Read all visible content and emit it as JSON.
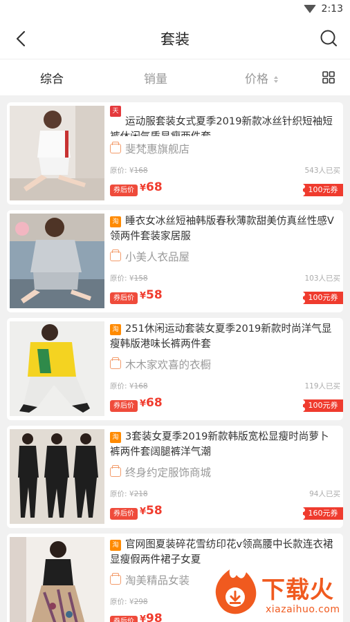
{
  "status_bar": {
    "time": "2:13"
  },
  "header": {
    "title": "套装"
  },
  "sort_tabs": [
    {
      "label": "综合",
      "active": true
    },
    {
      "label": "销量",
      "active": false
    },
    {
      "label": "价格",
      "active": false
    }
  ],
  "products": [
    {
      "platform": "tmall",
      "platform_label": "天猫",
      "title": "运动服套装女式夏季2019新款冰丝针织短袖短裤休闲气质显瘦两件套",
      "shop": "斐梵惠旗舰店",
      "original_price_label": "原价: ¥",
      "original_price": "168",
      "sold": "543人已买",
      "coupon_price_label": "券后价",
      "currency": "¥",
      "price": "68",
      "coupon": "100元券"
    },
    {
      "platform": "taobao",
      "platform_label": "淘",
      "title": "睡衣女冰丝短袖韩版春秋薄款甜美仿真丝性感V领两件套装家居服",
      "shop": "小美人衣品屋",
      "original_price_label": "原价: ¥",
      "original_price": "158",
      "sold": "103人已买",
      "coupon_price_label": "券后价",
      "currency": "¥",
      "price": "58",
      "coupon": "100元券"
    },
    {
      "platform": "taobao",
      "platform_label": "淘",
      "title": "251休闲运动套装女夏季2019新款时尚洋气显瘦韩版港味长裤两件套",
      "shop": "木木家欢喜的衣橱",
      "original_price_label": "原价: ¥",
      "original_price": "168",
      "sold": "119人已买",
      "coupon_price_label": "券后价",
      "currency": "¥",
      "price": "68",
      "coupon": "100元券"
    },
    {
      "platform": "taobao",
      "platform_label": "淘",
      "title": "3套装女夏季2019新款韩版宽松显瘦时尚萝卜裤两件套阔腿裤洋气潮",
      "shop": "终身约定服饰商城",
      "original_price_label": "原价: ¥",
      "original_price": "218",
      "sold": "94人已买",
      "coupon_price_label": "券后价",
      "currency": "¥",
      "price": "58",
      "coupon": "160元券"
    },
    {
      "platform": "taobao",
      "platform_label": "淘",
      "title": "官网图夏装碎花雪纺印花v领高腰中长款连衣裙显瘦假两件裙子女夏",
      "shop": "淘美精品女装",
      "original_price_label": "原价: ¥",
      "original_price": "298",
      "sold": "",
      "coupon_price_label": "券后价",
      "currency": "¥",
      "price": "98",
      "coupon": ""
    }
  ],
  "watermark": {
    "brand": "下载火",
    "domain": "xiazaihuo.com"
  },
  "colors": {
    "accent": "#ef3b2e",
    "tmall": "#e4393c",
    "taobao": "#ff8a00",
    "watermark": "#f05a1f"
  },
  "icons": {
    "back": "chevron-left-icon",
    "search": "search-icon",
    "layout": "grid-icon",
    "shop": "shop-icon",
    "wifi": "wifi-icon"
  }
}
